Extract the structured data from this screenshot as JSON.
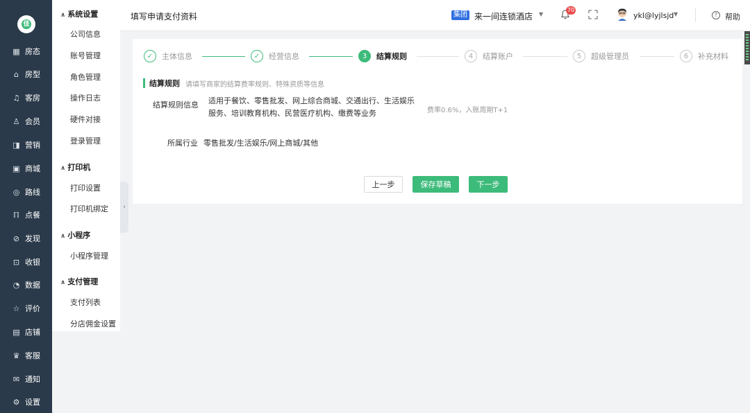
{
  "rail": {
    "logo_char": "佳",
    "items": [
      {
        "icon": "grid-icon",
        "glyph": "▦",
        "label": "房态"
      },
      {
        "icon": "house-icon",
        "glyph": "⌂",
        "label": "房型"
      },
      {
        "icon": "bell-icon",
        "glyph": "♫",
        "label": "客房"
      },
      {
        "icon": "users-icon",
        "glyph": "♙",
        "label": "会员"
      },
      {
        "icon": "marketing-icon",
        "glyph": "◨",
        "label": "营销"
      },
      {
        "icon": "shop-icon",
        "glyph": "▣",
        "label": "商城"
      },
      {
        "icon": "route-icon",
        "glyph": "◎",
        "label": "路线"
      },
      {
        "icon": "food-icon",
        "glyph": "ℿ",
        "label": "点餐"
      },
      {
        "icon": "compass-icon",
        "glyph": "⊘",
        "label": "发现"
      },
      {
        "icon": "cashier-icon",
        "glyph": "⊡",
        "label": "收银"
      },
      {
        "icon": "chart-icon",
        "glyph": "◔",
        "label": "数据"
      },
      {
        "icon": "star-icon",
        "glyph": "☆",
        "label": "评价"
      },
      {
        "icon": "store-icon",
        "glyph": "▤",
        "label": "店铺"
      },
      {
        "icon": "service-icon",
        "glyph": "♛",
        "label": "客服"
      },
      {
        "icon": "mail-icon",
        "glyph": "✉",
        "label": "通知"
      },
      {
        "icon": "gear-icon",
        "glyph": "⚙",
        "label": "设置"
      }
    ]
  },
  "submenu": {
    "groups": [
      {
        "title": "系统设置",
        "items": [
          "公司信息",
          "账号管理",
          "角色管理",
          "操作日志",
          "硬件对接",
          "登录管理"
        ]
      },
      {
        "title": "打印机",
        "items": [
          "打印设置",
          "打印机绑定"
        ]
      },
      {
        "title": "小程序",
        "items": [
          "小程序管理"
        ]
      },
      {
        "title": "支付管理",
        "items": [
          "支付列表",
          "分店佣金设置"
        ]
      }
    ]
  },
  "header": {
    "title": "填写申请支付资料",
    "group_badge": "集团",
    "store_name": "来一间连锁酒店",
    "notification_count": "70",
    "username": "ykl@lyjlsjd",
    "help": "帮助"
  },
  "steps": [
    {
      "num": "1",
      "label": "主体信息",
      "state": "done"
    },
    {
      "num": "2",
      "label": "经营信息",
      "state": "done"
    },
    {
      "num": "3",
      "label": "结算规则",
      "state": "active"
    },
    {
      "num": "4",
      "label": "结算账户",
      "state": "todo"
    },
    {
      "num": "5",
      "label": "超级管理员",
      "state": "todo"
    },
    {
      "num": "6",
      "label": "补充材料",
      "state": "todo"
    }
  ],
  "section": {
    "title": "结算规则",
    "hint": "请填写商家的结算费率规则、特殊资质等信息"
  },
  "form": {
    "rule_label": "结算规则信息",
    "rule_value": "适用于餐饮、零售批发、网上综合商城、交通出行、生活娱乐服务、培训教育机构、民营医疗机构、缴费等业务",
    "fee_text": "费率0.6%，入账周期T+1",
    "industry_label": "所属行业",
    "industry_value": "零售批发/生活娱乐/网上商城/其他"
  },
  "buttons": {
    "prev": "上一步",
    "save": "保存草稿",
    "next": "下一步"
  },
  "colors": {
    "accent": "#3dbb7a",
    "rail_bg": "#2b3a4a",
    "badge_blue": "#2f6fe0",
    "badge_red": "#e84d4d"
  }
}
